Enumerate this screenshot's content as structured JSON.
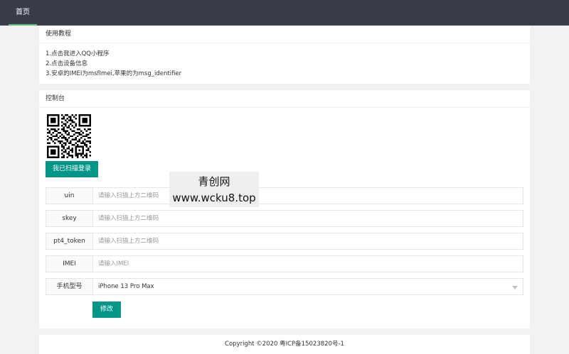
{
  "nav": {
    "home_label": "首页"
  },
  "tutorial": {
    "title": "使用教程",
    "lines": [
      "1.点击我进入QQ小程序",
      "2.点击设备信息",
      "3.安卓的IMEI为msfImei,苹果的为msg_identifier"
    ]
  },
  "console": {
    "title": "控制台",
    "scan_button": "我已扫描登录",
    "fields": [
      {
        "label": "uin",
        "placeholder": "请输入扫描上方二维码"
      },
      {
        "label": "skey",
        "placeholder": "请输入扫描上方二维码"
      },
      {
        "label": "pt4_token",
        "placeholder": "请输入扫描上方二维码"
      },
      {
        "label": "IMEI",
        "placeholder": "请输入IMEI"
      }
    ],
    "model": {
      "label": "手机型号",
      "selected": "iPhone 13 Pro Max"
    },
    "modify_button": "修改"
  },
  "watermark": {
    "line1": "青创网",
    "line2": "www.wcku8.top"
  },
  "footer": {
    "copyright": "Copyright ©2020 粤ICP备15023820号-1"
  },
  "colors": {
    "topbar": "#393d49",
    "nav_active": "#5fb878",
    "primary_button": "#009688"
  },
  "icons": {
    "qr": "qr-code-icon",
    "select_arrow": "chevron-down-icon"
  }
}
